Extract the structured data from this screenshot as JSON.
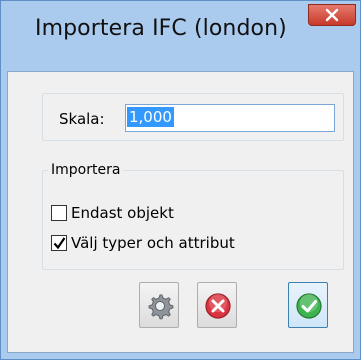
{
  "window": {
    "title": "Importera IFC (london)",
    "close_icon": "close-icon"
  },
  "scale": {
    "label": "Skala:",
    "value": "1,000"
  },
  "import_group": {
    "legend": "Importera",
    "options": [
      {
        "label": "Endast objekt",
        "checked": false
      },
      {
        "label": "Välj typer och attribut",
        "checked": true
      }
    ]
  },
  "buttons": [
    {
      "icon": "settings-gear-icon"
    },
    {
      "icon": "cancel-icon",
      "color": "#d9343f"
    },
    {
      "icon": "ok-check-icon",
      "color": "#3fb34f"
    }
  ],
  "colors": {
    "frame": "#aacbee",
    "close": "#c7392a",
    "selection": "#3399ff"
  }
}
